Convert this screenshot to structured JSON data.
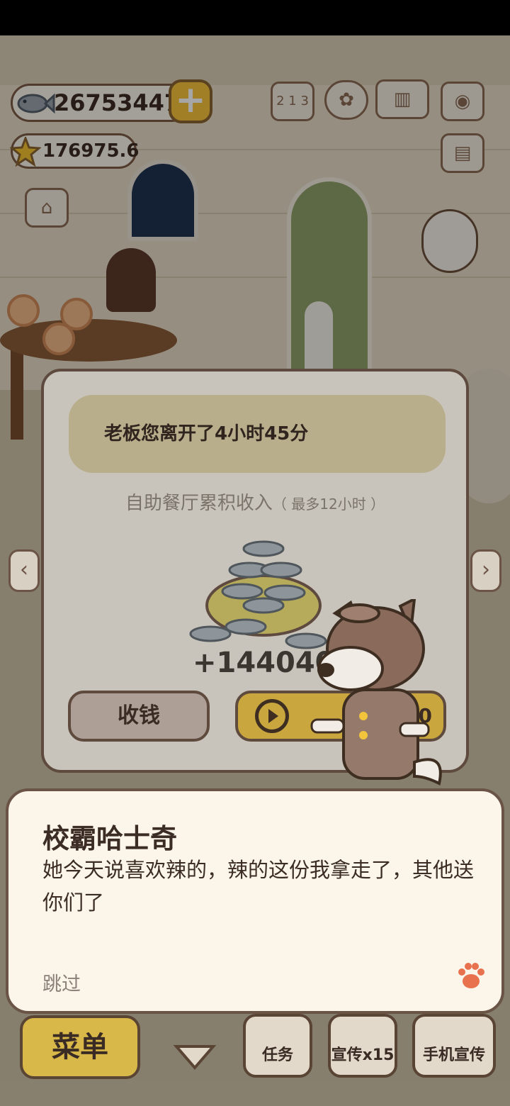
{
  "hud": {
    "fish_count": "26753447",
    "star_count": "176975.6",
    "plus_label": "+",
    "leaderboard_label": "2 1 3"
  },
  "offline_dialog": {
    "away_message": "老板您离开了4小时45分",
    "income_label": "自助餐厅累积收入",
    "income_limit": "（ 最多12小时 ）",
    "income_amount": "+144040",
    "collect_label": "收钱",
    "ad_bonus_value": "60"
  },
  "speech": {
    "speaker": "校霸哈士奇",
    "text": "她今天说喜欢辣的，辣的这份我拿走了，其他送你们了",
    "skip_label": "跳过"
  },
  "bottom_bar": {
    "menu_label": "菜单",
    "tasks_label": "任务",
    "promote_label": "宣传x15",
    "phone_promote_label": "手机宣传"
  },
  "colors": {
    "accent_yellow": "#f6c43c",
    "outline_brown": "#5e4a3e",
    "dialog_bg": "#fcf5ea"
  }
}
